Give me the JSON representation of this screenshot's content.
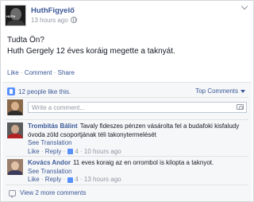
{
  "post": {
    "page_name": "HuthFigyelő",
    "timestamp": "13 hours ago",
    "avatar_tag": "HUTH",
    "text_line1": "Tudta Ön?",
    "text_line2": "Huth Gergely 12 éves koráig megette a taknyát."
  },
  "actions": {
    "like": "Like",
    "comment": "Comment",
    "share": "Share",
    "dot": "·"
  },
  "feedback": {
    "likes_text": "12 people like this.",
    "top_comments": "Top Comments",
    "comment_placeholder": "Write a comment...",
    "view_more": "View 2 more comments"
  },
  "comments": [
    {
      "author": "Trombitás Bálint",
      "text": "Tavaly fideszes pénzen vásárolta fel a budafoki kisfaludy óvoda zöld csoportjának téli takonytermelését",
      "see_translation": "See Translation",
      "like": "Like",
      "reply": "Reply",
      "likes": "4",
      "time": "10 hours ago"
    },
    {
      "author": "Kovács Andor",
      "text": "11 eves koraig az en orrombol is kilopta a taknyot.",
      "see_translation": "See Translation",
      "like": "Like",
      "reply": "Reply",
      "likes": "4",
      "time": "13 hours ago"
    }
  ],
  "colors": {
    "link": "#3b5998",
    "meta": "#9197a3",
    "like_blue": "#5890ff"
  }
}
